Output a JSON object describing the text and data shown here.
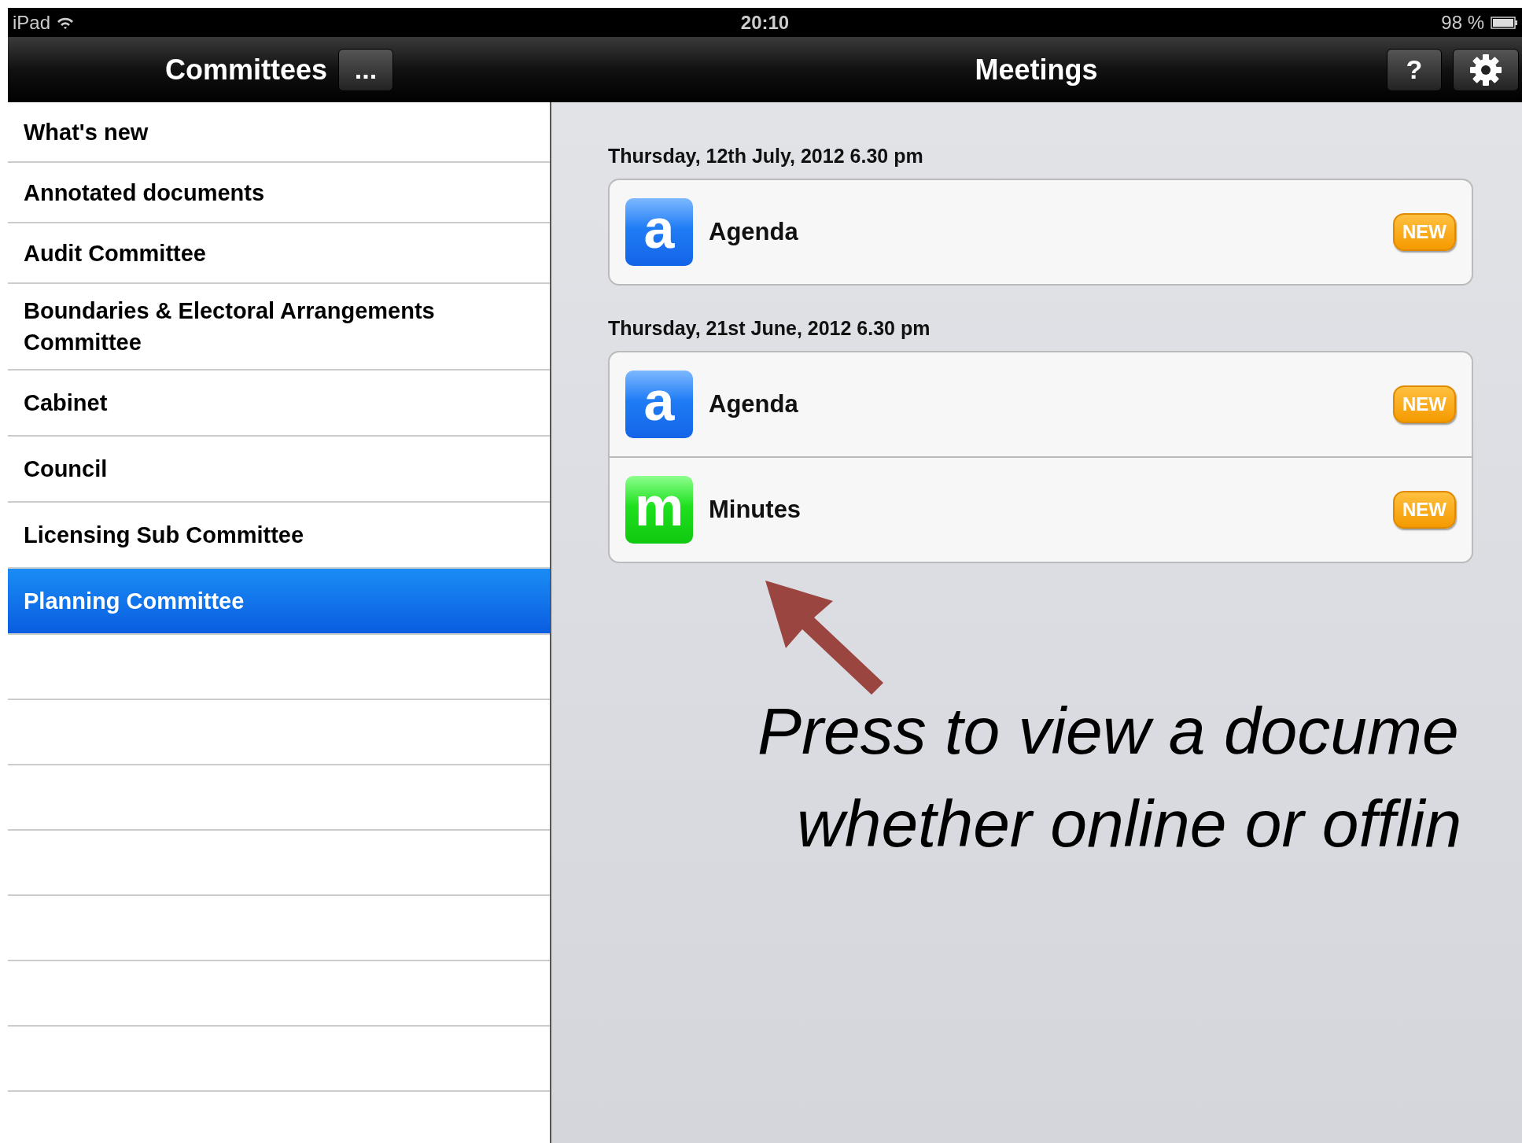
{
  "status_bar": {
    "device": "iPad",
    "time": "20:10",
    "battery": "98 %"
  },
  "nav_bar": {
    "left_title": "Committees",
    "more_button": "...",
    "title": "Meetings",
    "help_button": "?"
  },
  "sidebar": {
    "items": [
      {
        "label": "What's new",
        "selected": false
      },
      {
        "label": "Annotated documents",
        "selected": false
      },
      {
        "label": "Audit Committee",
        "selected": false
      },
      {
        "label": "Boundaries & Electoral Arrangements Committee",
        "selected": false
      },
      {
        "label": "Cabinet",
        "selected": false
      },
      {
        "label": "Council",
        "selected": false
      },
      {
        "label": "Licensing Sub Committee",
        "selected": false
      },
      {
        "label": "Planning Committee",
        "selected": true
      }
    ]
  },
  "meetings": [
    {
      "date": "Thursday, 12th July, 2012 6.30 pm",
      "documents": [
        {
          "kind": "agenda",
          "icon_letter": "a",
          "label": "Agenda",
          "badge": "NEW"
        }
      ]
    },
    {
      "date": "Thursday, 21st June, 2012 6.30 pm",
      "documents": [
        {
          "kind": "agenda",
          "icon_letter": "a",
          "label": "Agenda",
          "badge": "NEW"
        },
        {
          "kind": "minutes",
          "icon_letter": "m",
          "label": "Minutes",
          "badge": "NEW"
        }
      ]
    }
  ],
  "callout": {
    "lines": [
      "Press to view a docume",
      "whether online or offlin"
    ]
  }
}
